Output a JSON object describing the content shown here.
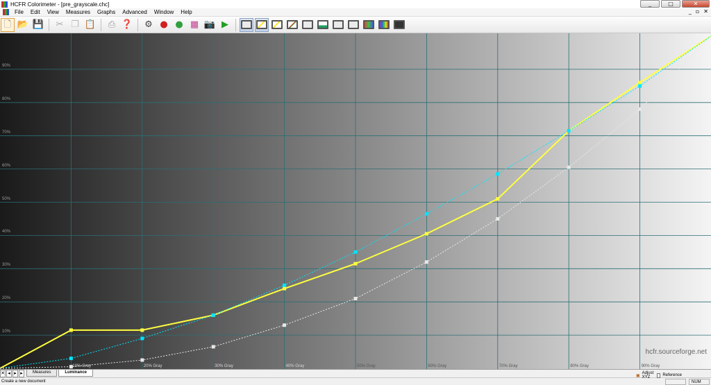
{
  "window": {
    "title": "HCFR Colorimeter - [pre_grayscale.chc]",
    "minimize": "_",
    "maximize": "□",
    "close": "✕"
  },
  "menu": {
    "items": [
      "File",
      "Edit",
      "View",
      "Measures",
      "Graphs",
      "Advanced",
      "Window",
      "Help"
    ],
    "mdi_controls": [
      "_",
      "▫",
      "✕"
    ]
  },
  "toolbar": {
    "buttons": [
      "new-document",
      "open-folder",
      "save-disk",
      "cut-scissors",
      "copy",
      "paste",
      "print",
      "help"
    ]
  },
  "chart_data": {
    "type": "line",
    "ylim": [
      0,
      100
    ],
    "y_ticks": [
      "10%",
      "20%",
      "30%",
      "40%",
      "50%",
      "60%",
      "70%",
      "80%",
      "90%"
    ],
    "x_ticks": [
      "10% Gray",
      "20% Gray",
      "30% Gray",
      "40% Gray",
      "50% Gray",
      "60% Gray",
      "70% Gray",
      "80% Gray",
      "90% Gray"
    ],
    "x": [
      0,
      10,
      20,
      30,
      40,
      50,
      60,
      70,
      80,
      90,
      100
    ],
    "grid": true,
    "series": [
      {
        "color": "#ffff40",
        "values": [
          0,
          11.5,
          11.5,
          16,
          24,
          31.5,
          40.5,
          51,
          71.5,
          86,
          100
        ]
      },
      {
        "color": "#00e5ff",
        "values": [
          0,
          3,
          9,
          16,
          25,
          35,
          46.5,
          58.5,
          71.5,
          85,
          100
        ]
      },
      {
        "color": "#e8e8e8",
        "values": [
          0,
          0.5,
          2.5,
          6.5,
          13,
          21,
          32,
          45,
          60.5,
          78,
          100
        ]
      }
    ],
    "background_gradient": {
      "from": "#1a1a1a",
      "to": "#f4f4f4"
    },
    "watermark": "hcfr.sourceforge.net"
  },
  "tabs": {
    "items": [
      "Measures",
      "Luminance"
    ],
    "active": "Luminance"
  },
  "status": {
    "text": "Create a new document",
    "adjust_label": "Adjust XYZ",
    "reference_label": "Reference",
    "num": "NUM"
  }
}
